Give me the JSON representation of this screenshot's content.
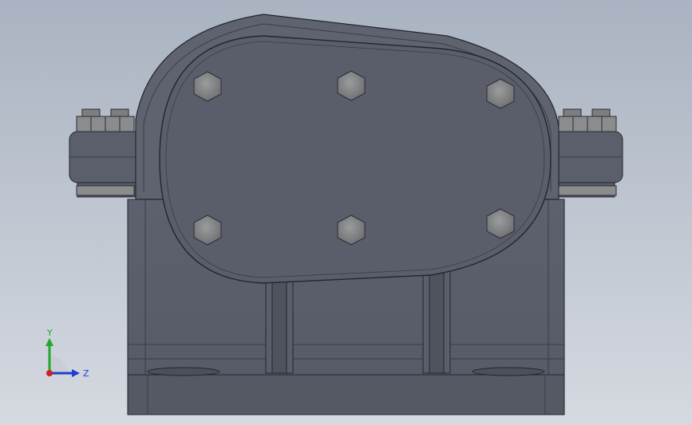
{
  "viewport": {
    "background_top": "#a9b3c1",
    "background_bottom": "#d5d9e0",
    "model_body_color": "#5b5f6c",
    "model_edge_color": "#23262d",
    "cover_color": "#5a5e6b",
    "bolt_color": "#8a8c8e"
  },
  "triad": {
    "y_label": "Y",
    "z_label": "Z",
    "y_color": "#1fa82e",
    "z_color": "#1d3fd1",
    "x_color": "#d12020"
  }
}
